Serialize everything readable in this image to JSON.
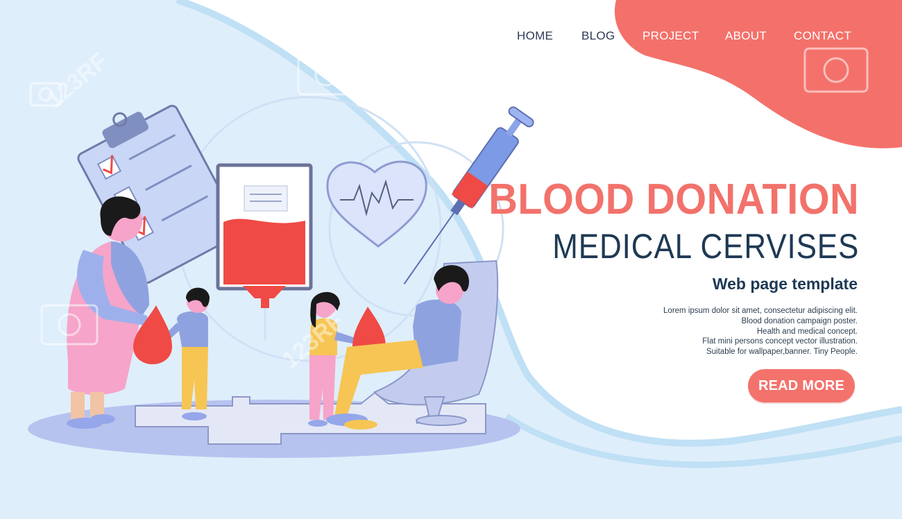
{
  "nav": {
    "items": [
      {
        "label": "HOME"
      },
      {
        "label": "BLOG"
      },
      {
        "label": "PROJECT"
      },
      {
        "label": "ABOUT"
      },
      {
        "label": "CONTACT"
      }
    ]
  },
  "hero": {
    "title": "BLOOD DONATION",
    "subtitle": "MEDICAL CERVISES",
    "tagline": "Web page template",
    "description": [
      "Lorem ipsum dolor sit amet, consectetur adipiscing elit.",
      "Blood donation campaign poster.",
      "Health and medical concept.",
      "Flat mini persons concept vector illustration.",
      "Suitable for wallpaper,banner. Tiny People."
    ],
    "cta_label": "READ MORE"
  },
  "watermark": {
    "text": "123RF"
  },
  "colors": {
    "accent": "#f4726c",
    "title_red": "#f2726b",
    "navy": "#1e3954",
    "background": "#dfeefb",
    "blood": "#ef4a45"
  },
  "icons": [
    "clipboard-checklist-icon",
    "blood-bag-icon",
    "heart-pulse-icon",
    "syringe-icon",
    "blood-drop-icon",
    "camera-watermark-icon"
  ]
}
